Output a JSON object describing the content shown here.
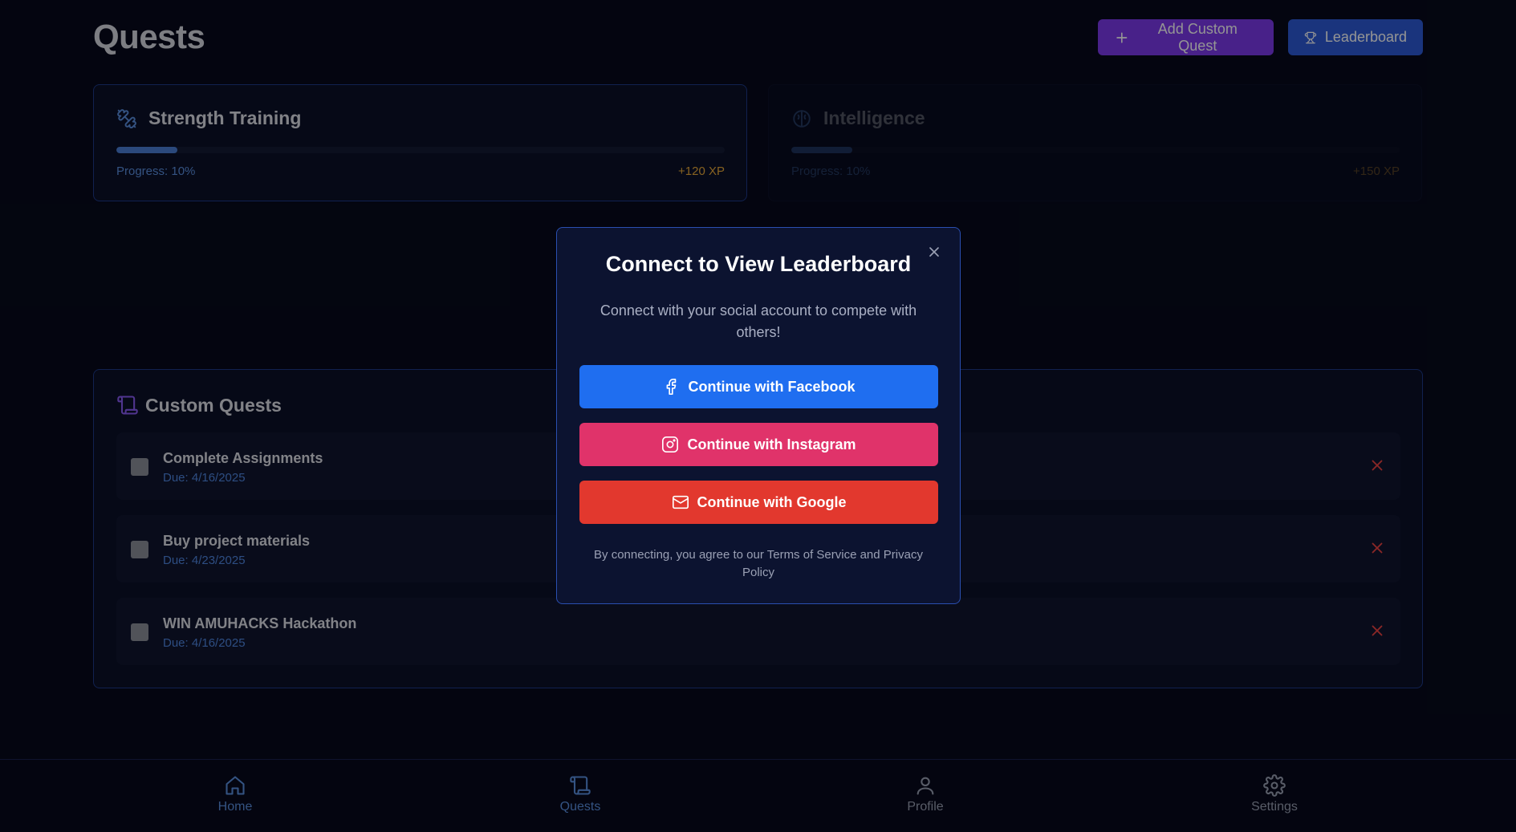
{
  "page": {
    "title": "Quests",
    "add_quest_label": "Add Custom Quest",
    "leaderboard_label": "Leaderboard"
  },
  "stats": [
    {
      "name": "Strength Training",
      "progress_label": "Progress: 10%",
      "progress": 0.1,
      "xp": "+120 XP",
      "icon": "dumbbell-icon"
    },
    {
      "name": "Intelligence",
      "progress_label": "Progress: 10%",
      "progress": 0.1,
      "xp": "+150 XP",
      "icon": "brain-icon"
    }
  ],
  "custom_quests": {
    "title": "Custom Quests",
    "items": [
      {
        "name": "Complete Assignments",
        "due": "Due: 4/16/2025"
      },
      {
        "name": "Buy project materials",
        "due": "Due: 4/23/2025"
      },
      {
        "name": "WIN AMUHACKS Hackathon",
        "due": "Due: 4/16/2025"
      }
    ]
  },
  "modal": {
    "title": "Connect to View Leaderboard",
    "subtitle": "Connect with your social account to compete with others!",
    "facebook_label": "Continue with Facebook",
    "instagram_label": "Continue with Instagram",
    "google_label": "Continue with Google",
    "terms": "By connecting, you agree to our Terms of Service and Privacy Policy"
  },
  "nav": {
    "home": "Home",
    "quests": "Quests",
    "profile": "Profile",
    "settings": "Settings"
  },
  "colors": {
    "accent_purple": "#7c3aed",
    "accent_blue": "#2d5bd7",
    "facebook": "#1f6ef0",
    "instagram": "#e0336a",
    "google": "#e2382e",
    "xp": "#e8a93a",
    "delete": "#ef4444"
  }
}
